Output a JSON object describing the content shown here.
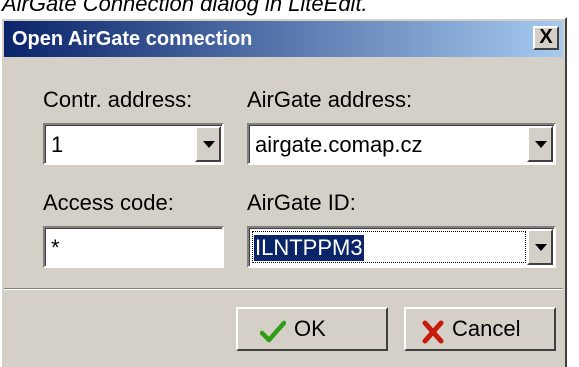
{
  "caption": "AirGate Connection dialog in LiteEdit.",
  "dialog": {
    "title": "Open AirGate connection",
    "close_label": "X",
    "contr_address": {
      "label": "Contr. address:",
      "value": "1"
    },
    "airgate_address": {
      "label": "AirGate address:",
      "value": "airgate.comap.cz"
    },
    "access_code": {
      "label": "Access code:",
      "value": "*"
    },
    "airgate_id": {
      "label": "AirGate ID:",
      "value": "ILNTPPM3"
    },
    "ok_label": "OK",
    "cancel_label": "Cancel"
  },
  "colors": {
    "title_gradient_start": "#0a246a",
    "title_gradient_end": "#a6caf0",
    "dialog_face": "#d4d0c8",
    "ok_check": "#2e9e14",
    "cancel_x": "#c81a0a"
  },
  "icons": {
    "ok": "checkmark-icon",
    "cancel": "x-mark-icon",
    "dropdown": "chevron-down-icon"
  }
}
